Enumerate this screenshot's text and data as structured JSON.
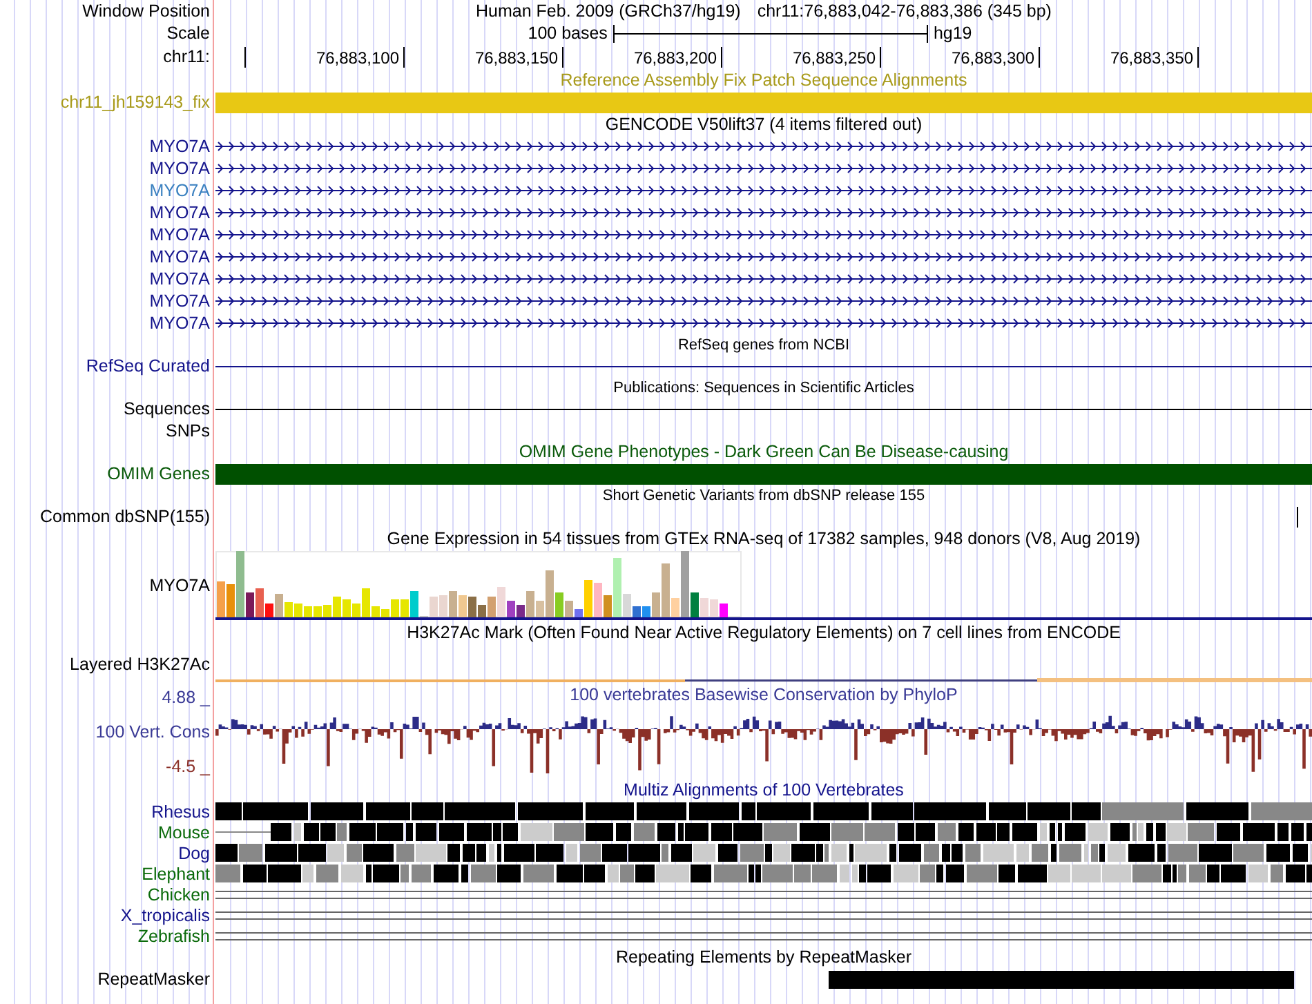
{
  "header": {
    "position_label": "Window Position",
    "assembly_title": "Human Feb. 2009 (GRCh37/hg19)",
    "position": "chr11:76,883,042-76,883,386 (345 bp)",
    "scale_label": "Scale",
    "scale_text": "100 bases",
    "scale_db": "hg19",
    "chrom_label": "chr11:",
    "ticks": [
      "76,883,100",
      "76,883,150",
      "76,883,200",
      "76,883,250",
      "76,883,300",
      "76,883,350"
    ]
  },
  "tracks": [
    {
      "kind": "bar",
      "title": {
        "text": "Reference Assembly Fix Patch Sequence Alignments",
        "color": "#a89a1a"
      },
      "rows": [
        {
          "label": "chr11_jh159143_fix",
          "color": "#a89a1a",
          "bar": {
            "color": "#e8c814"
          }
        }
      ]
    },
    {
      "kind": "genes",
      "title": {
        "text": "GENCODE V50lift37 (4 items filtered out)",
        "color": "#000000"
      },
      "rows": [
        {
          "label": "MYO7A",
          "selected": false
        },
        {
          "label": "MYO7A",
          "selected": false
        },
        {
          "label": "MYO7A",
          "selected": true
        },
        {
          "label": "MYO7A",
          "selected": false
        },
        {
          "label": "MYO7A",
          "selected": false
        },
        {
          "label": "MYO7A",
          "selected": false
        },
        {
          "label": "MYO7A",
          "selected": false
        },
        {
          "label": "MYO7A",
          "selected": false
        },
        {
          "label": "MYO7A",
          "selected": false
        }
      ]
    },
    {
      "kind": "line",
      "title": {
        "text": "RefSeq genes from NCBI",
        "color": "#000000"
      },
      "rows": [
        {
          "label": "RefSeq Curated",
          "color": "#14148c"
        }
      ]
    },
    {
      "kind": "line",
      "title": {
        "text": "Publications: Sequences in Scientific Articles",
        "color": "#000000"
      },
      "rows": [
        {
          "label": "Sequences",
          "color": "#000000"
        },
        {
          "label": "SNPs",
          "color": "#000000",
          "kind": "empty"
        }
      ]
    },
    {
      "kind": "bar",
      "title": {
        "text": "OMIM Gene Phenotypes - Dark Green Can Be Disease-causing",
        "color": "#0a5a0a"
      },
      "rows": [
        {
          "label": "OMIM Genes",
          "color": "#0a5a0a",
          "bar": {
            "color": "#005000"
          }
        }
      ]
    },
    {
      "kind": "tick",
      "title": {
        "text": "Short Genetic Variants from dbSNP release 155",
        "color": "#000000"
      },
      "rows": [
        {
          "label": "Common dbSNP(155)",
          "color": "#000000"
        }
      ]
    },
    {
      "kind": "expression",
      "title": {
        "text": "Gene Expression in 54 tissues from GTEx RNA-seq of 17382 samples, 948 donors (V8, Aug 2019)",
        "color": "#000000"
      },
      "rows": [
        {
          "label": "MYO7A",
          "color": "#000000"
        }
      ]
    },
    {
      "kind": "signal",
      "title": {
        "text": "H3K27Ac Mark (Often Found Near Active Regulatory Elements) on 7 cell lines from ENCODE",
        "color": "#000000"
      },
      "rows": [
        {
          "label": "Layered H3K27Ac",
          "color": "#000000"
        }
      ]
    },
    {
      "kind": "conservation",
      "title": {
        "text": "100 vertebrates Basewise Conservation by PhyloP",
        "color": "#3a3a96"
      },
      "max_label": "4.88 _",
      "min_label": "-4.5 _",
      "rows": [
        {
          "label": "100 Vert. Cons",
          "color": "#3a3a96"
        }
      ]
    },
    {
      "kind": "alignment",
      "title": {
        "text": "Multiz Alignments of 100 Vertebrates",
        "color": "#14148c"
      },
      "rows": [
        {
          "label": "Rhesus",
          "color": "#14148c",
          "kind": "blocks"
        },
        {
          "label": "Mouse",
          "color": "#0a6a0a",
          "kind": "blocks"
        },
        {
          "label": "Dog",
          "color": "#14148c",
          "kind": "blocks"
        },
        {
          "label": "Elephant",
          "color": "#0a6a0a",
          "kind": "blocks"
        },
        {
          "label": "Chicken",
          "color": "#0a6a0a",
          "kind": "lines"
        },
        {
          "label": "X_tropicalis",
          "color": "#14148c",
          "kind": "lines"
        },
        {
          "label": "Zebrafish",
          "color": "#0a6a0a",
          "kind": "lines"
        }
      ]
    },
    {
      "kind": "repeat",
      "title": {
        "text": "Repeating Elements by RepeatMasker",
        "color": "#000000"
      },
      "rows": [
        {
          "label": "RepeatMasker",
          "color": "#000000"
        }
      ]
    }
  ]
}
